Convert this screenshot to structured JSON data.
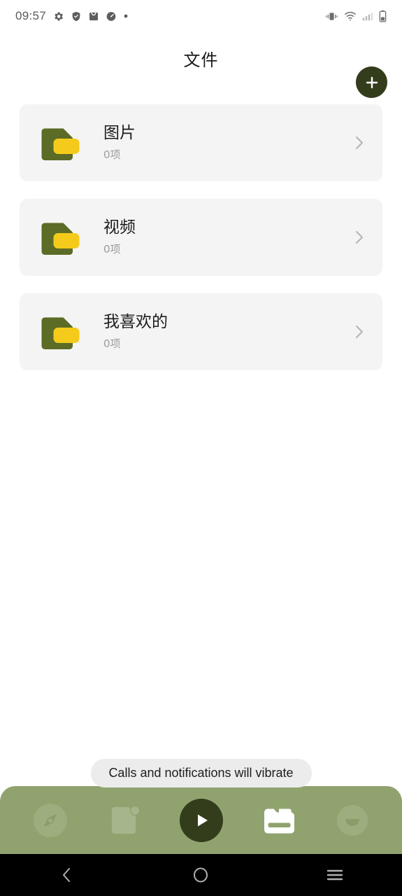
{
  "status_bar": {
    "time": "09:57",
    "left_icons": [
      {
        "name": "gear-icon"
      },
      {
        "name": "shield-check-icon"
      },
      {
        "name": "inbox-icon"
      },
      {
        "name": "speedometer-icon"
      },
      {
        "name": "dot-icon"
      }
    ],
    "right_icons": [
      {
        "name": "vibrate-icon"
      },
      {
        "name": "wifi-icon"
      },
      {
        "name": "cellular-signal-icon"
      },
      {
        "name": "battery-icon"
      }
    ]
  },
  "header": {
    "title": "文件",
    "add_button_label": "+"
  },
  "list": {
    "items": [
      {
        "title": "图片",
        "subtitle": "0项"
      },
      {
        "title": "视频",
        "subtitle": "0项"
      },
      {
        "title": "我喜欢的",
        "subtitle": "0项"
      }
    ]
  },
  "toast": {
    "message": "Calls and notifications will vibrate"
  },
  "dock": {
    "items": [
      {
        "name": "compass-icon",
        "active": false
      },
      {
        "name": "document-badge-icon",
        "active": false
      },
      {
        "name": "play-icon",
        "active": true
      },
      {
        "name": "folder-icon",
        "active": true
      },
      {
        "name": "smiley-icon",
        "active": false
      }
    ]
  },
  "nav_bar": {
    "buttons": [
      {
        "name": "back-button"
      },
      {
        "name": "home-button"
      },
      {
        "name": "recents-button"
      }
    ]
  },
  "colors": {
    "dock_background": "#90a36f",
    "accent_dark": "#333d1c",
    "folder_green": "#5c6b26",
    "folder_yellow": "#f5cb1b",
    "card_background": "#f4f4f4"
  }
}
